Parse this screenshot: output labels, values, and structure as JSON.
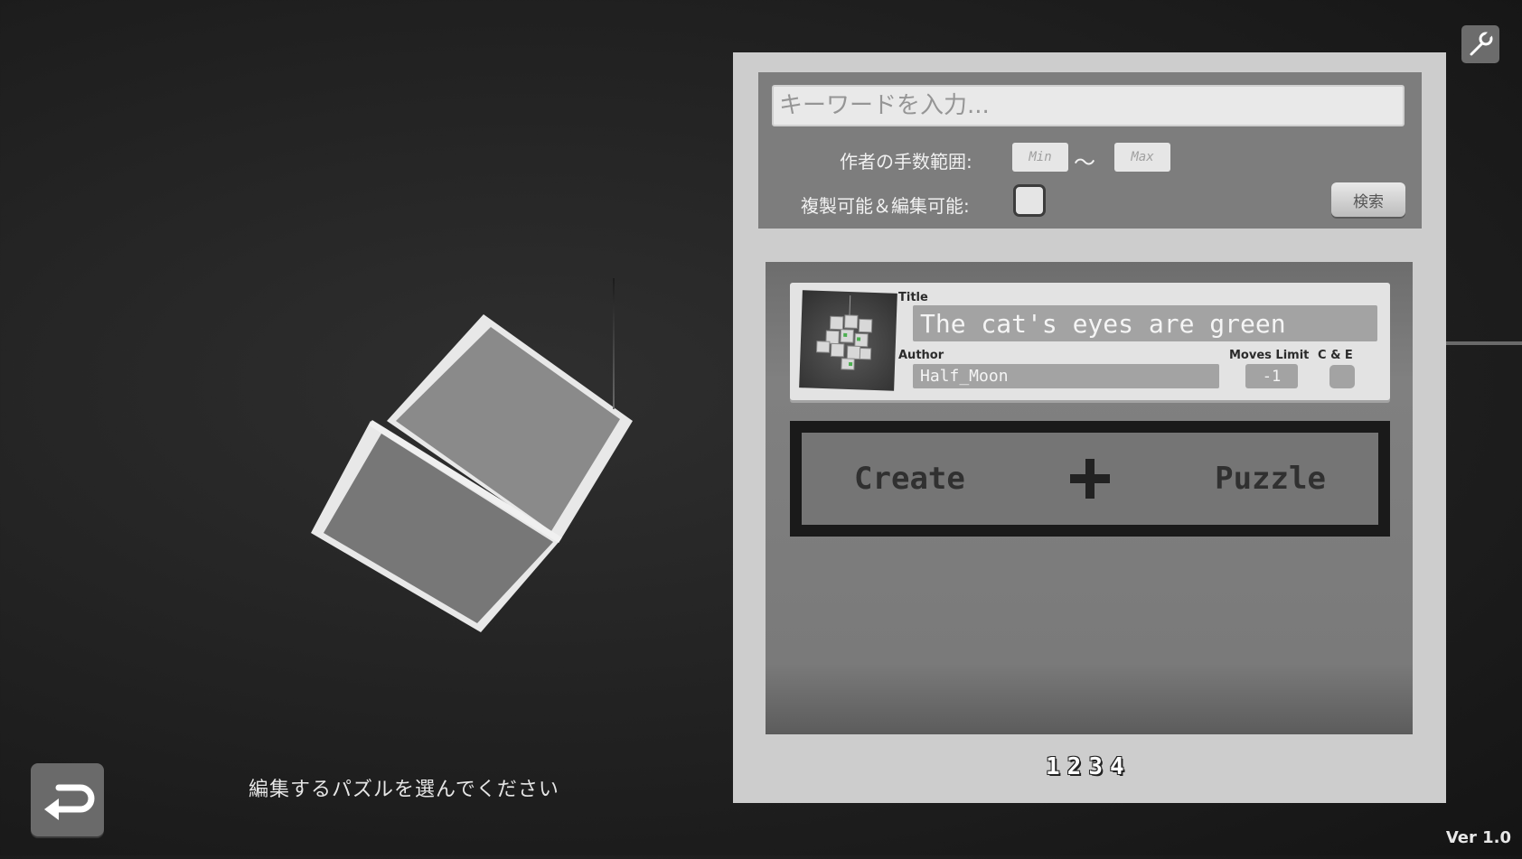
{
  "scene": {
    "instruction": "編集するパズルを選んでください"
  },
  "version": "Ver 1.0",
  "search": {
    "keyword_placeholder": "キーワードを入力...",
    "keyword_value": "",
    "range_label": "作者の手数範囲:",
    "min_placeholder": "Min",
    "max_placeholder": "Max",
    "range_separator": "～",
    "clone_edit_label": "複製可能＆編集可能:",
    "clone_edit_checked": false,
    "search_button": "検索"
  },
  "puzzles": [
    {
      "title_label": "Title",
      "title": "The cat's eyes are green",
      "author_label": "Author",
      "author": "Half_Moon",
      "moves_label": "Moves Limit",
      "moves": "-1",
      "ce_label": "C & E"
    }
  ],
  "create": {
    "left": "Create",
    "right": "Puzzle"
  },
  "pages": [
    "1",
    "2",
    "3",
    "4"
  ],
  "colors": {
    "panel": "#cdcdcd",
    "search_box": "#7d7d7d",
    "card": "#e3e3e3",
    "field": "#a3a3a3"
  },
  "icons": {
    "back": "return-arrow-icon",
    "settings": "wrench-icon"
  }
}
